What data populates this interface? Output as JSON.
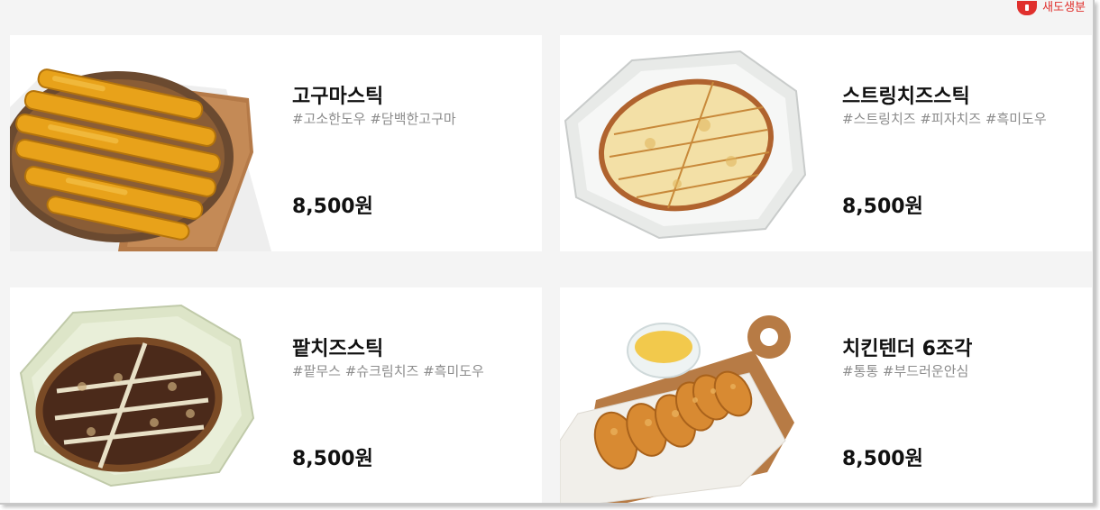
{
  "badge": {
    "label": "새도생분",
    "icon": "brand-icon"
  },
  "menu": [
    {
      "name": "고구마스틱",
      "tags": "#고소한도우 #담백한고구마",
      "price": "8,500원",
      "image": "sweet-potato-stick-pizza"
    },
    {
      "name": "스트링치즈스틱",
      "tags": "#스트링치즈 #피자치즈 #흑미도우",
      "price": "8,500원",
      "image": "string-cheese-stick-pizza"
    },
    {
      "name": "팥치즈스틱",
      "tags": "#팥무스 #슈크림치즈 #흑미도우",
      "price": "8,500원",
      "image": "red-bean-cheese-stick-pizza"
    },
    {
      "name": "치킨텐더 6조각",
      "tags": "#통통 #부드러운안심",
      "price": "8,500원",
      "image": "chicken-tenders"
    }
  ]
}
